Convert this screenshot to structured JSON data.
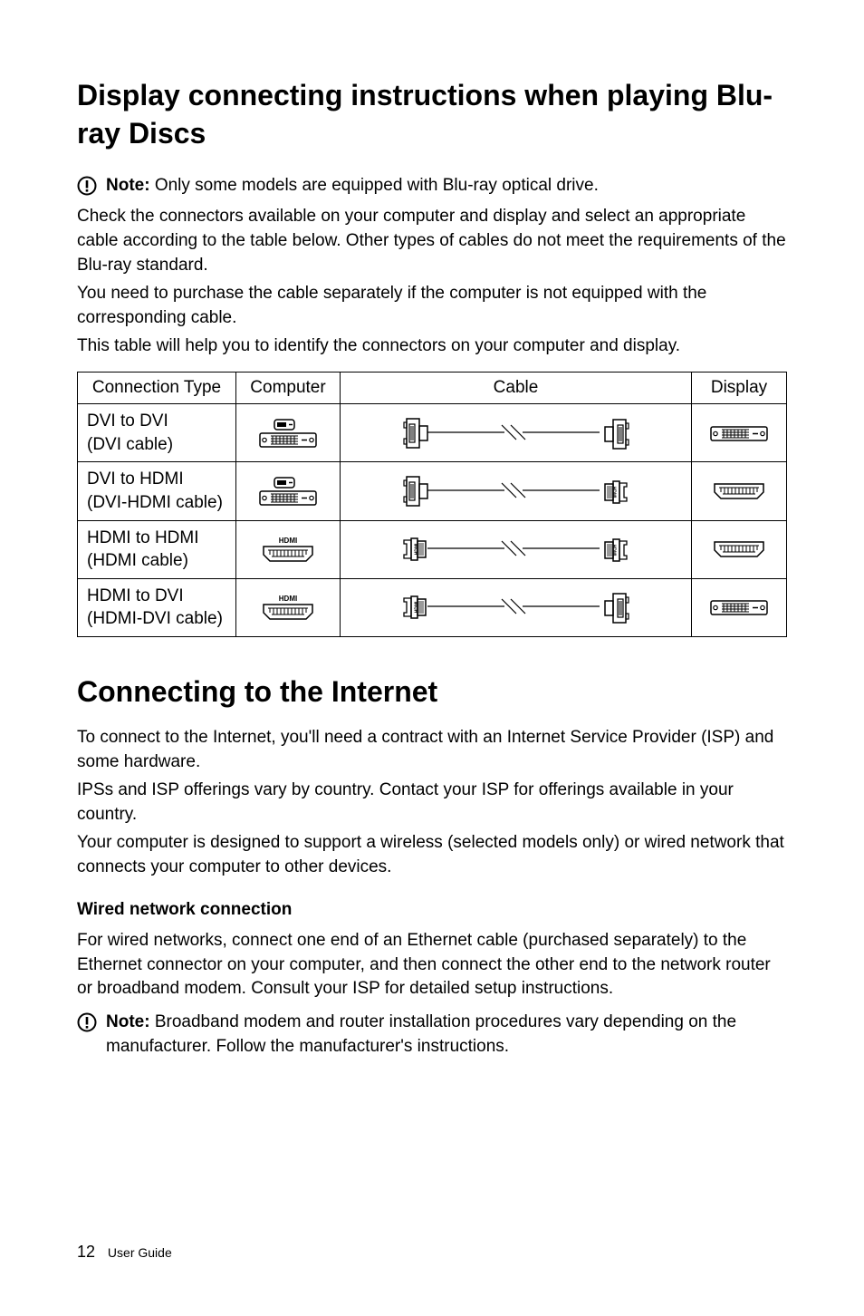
{
  "heading1": "Display connecting instructions when playing Blu-ray Discs",
  "note1_label": "Note:",
  "note1_text": " Only some models are equipped with Blu-ray optical drive.",
  "para1": "Check the connectors available on your computer and display and select an appropriate cable according to the table below. Other types of cables do not meet the requirements of the Blu-ray standard.",
  "para2": "You need to purchase the cable separately if the computer is not equipped with the corresponding cable.",
  "para3": "This table will help you to identify the connectors on your computer and display.",
  "table": {
    "headers": [
      "Connection Type",
      "Computer",
      "Cable",
      "Display"
    ],
    "rows": [
      {
        "type": "DVI to DVI\n(DVI cable)",
        "computer": "dvi-port",
        "cable": "dvi-dvi-cable",
        "display": "dvi-port"
      },
      {
        "type": "DVI to HDMI\n(DVI-HDMI cable)",
        "computer": "dvi-port",
        "cable": "dvi-hdmi-cable",
        "display": "hdmi-port"
      },
      {
        "type": "HDMI to HDMI\n(HDMI cable)",
        "computer": "hdmi-port",
        "cable": "hdmi-hdmi-cable",
        "display": "hdmi-port"
      },
      {
        "type": "HDMI to DVI\n(HDMI-DVI cable)",
        "computer": "hdmi-port",
        "cable": "hdmi-dvi-cable",
        "display": "dvi-port"
      }
    ]
  },
  "heading2": "Connecting to the Internet",
  "para4": "To connect to the Internet, you'll need a contract with an Internet Service Provider (ISP) and some hardware.",
  "para5": "IPSs and ISP offerings vary by country. Contact your ISP for offerings available in your country.",
  "para6": "Your computer is designed to support a wireless (selected models only) or wired network that connects your computer to other devices.",
  "subhead1": "Wired network connection",
  "para7": "For wired networks, connect one end of an Ethernet cable (purchased separately) to the Ethernet connector on your computer, and then connect the other end to the network router or broadband modem. Consult your ISP for detailed setup instructions.",
  "note2_label": "Note:",
  "note2_text": " Broadband modem and router installation procedures vary depending on the manufacturer. Follow the manufacturer's instructions.",
  "footer_page": "12",
  "footer_label": "User Guide"
}
